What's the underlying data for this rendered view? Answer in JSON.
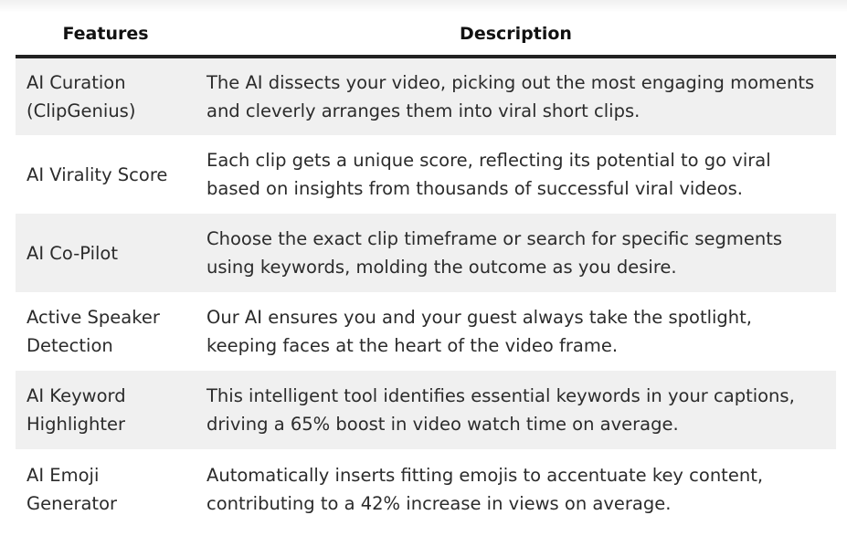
{
  "table": {
    "headers": {
      "features": "Features",
      "description": "Description"
    },
    "rows": [
      {
        "feature": "AI Curation (ClipGenius)",
        "description": "The AI dissects your video, picking out the most engaging moments and cleverly arranges them into viral short clips."
      },
      {
        "feature": "AI Virality Score",
        "description": "Each clip gets a unique score, reflecting its potential to go viral based on insights from thousands of successful viral videos."
      },
      {
        "feature": "AI Co-Pilot",
        "description": "Choose the exact clip timeframe or search for specific segments using keywords, molding the outcome as you desire."
      },
      {
        "feature": "Active Speaker Detection",
        "description": "Our AI ensures you and your guest always take the spotlight, keeping faces at the heart of the video frame."
      },
      {
        "feature": "AI Keyword Highlighter",
        "description": "This intelligent tool identifies essential keywords in your captions, driving a 65% boost in video watch time on average."
      },
      {
        "feature": "AI Emoji Generator",
        "description": "Automatically inserts fitting emojis to accentuate key content, contributing to a 42% increase in views on average."
      }
    ]
  },
  "colors": {
    "shaded_row": "#f0f0f0",
    "header_rule": "#222222",
    "text": "#2b2b2b"
  }
}
